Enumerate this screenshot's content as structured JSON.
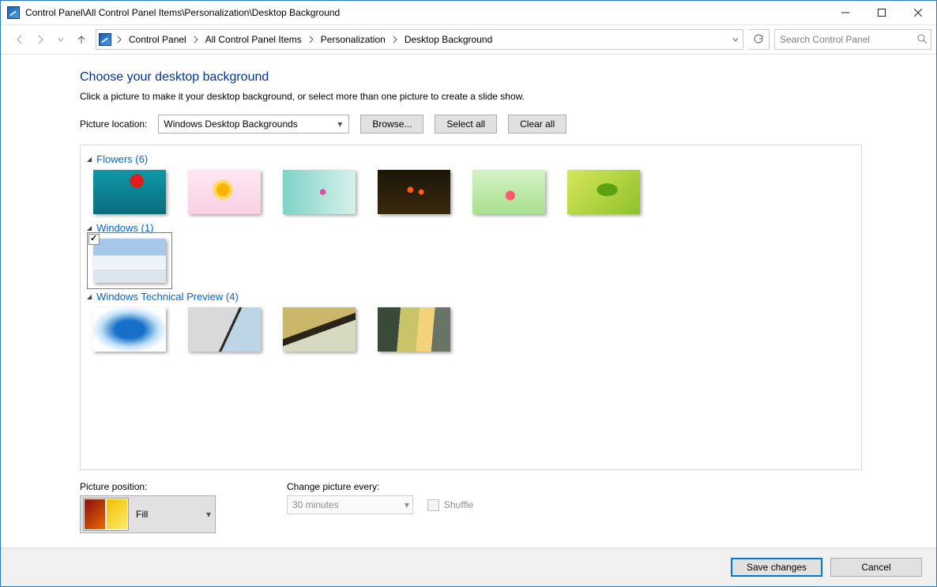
{
  "window": {
    "title": "Control Panel\\All Control Panel Items\\Personalization\\Desktop Background"
  },
  "breadcrumb": [
    "Control Panel",
    "All Control Panel Items",
    "Personalization",
    "Desktop Background"
  ],
  "search": {
    "placeholder": "Search Control Panel"
  },
  "page": {
    "heading": "Choose your desktop background",
    "sub": "Click a picture to make it your desktop background, or select more than one picture to create a slide show."
  },
  "toolbar": {
    "picture_location_label": "Picture location:",
    "picture_location_value": "Windows Desktop Backgrounds",
    "browse": "Browse...",
    "select_all": "Select all",
    "clear_all": "Clear all"
  },
  "groups": [
    {
      "name": "Flowers (6)",
      "thumbs": [
        "t-f1",
        "t-f2",
        "t-f3",
        "t-f4",
        "t-f5",
        "t-f6"
      ],
      "selected": []
    },
    {
      "name": "Windows (1)",
      "thumbs": [
        "t-w1"
      ],
      "selected": [
        0
      ]
    },
    {
      "name": "Windows Technical Preview (4)",
      "thumbs": [
        "t-p1",
        "t-p2",
        "t-p3",
        "t-p4"
      ],
      "selected": []
    }
  ],
  "position": {
    "label": "Picture position:",
    "value": "Fill"
  },
  "change": {
    "label": "Change picture every:",
    "value": "30 minutes",
    "shuffle_label": "Shuffle"
  },
  "footer": {
    "save": "Save changes",
    "cancel": "Cancel"
  }
}
